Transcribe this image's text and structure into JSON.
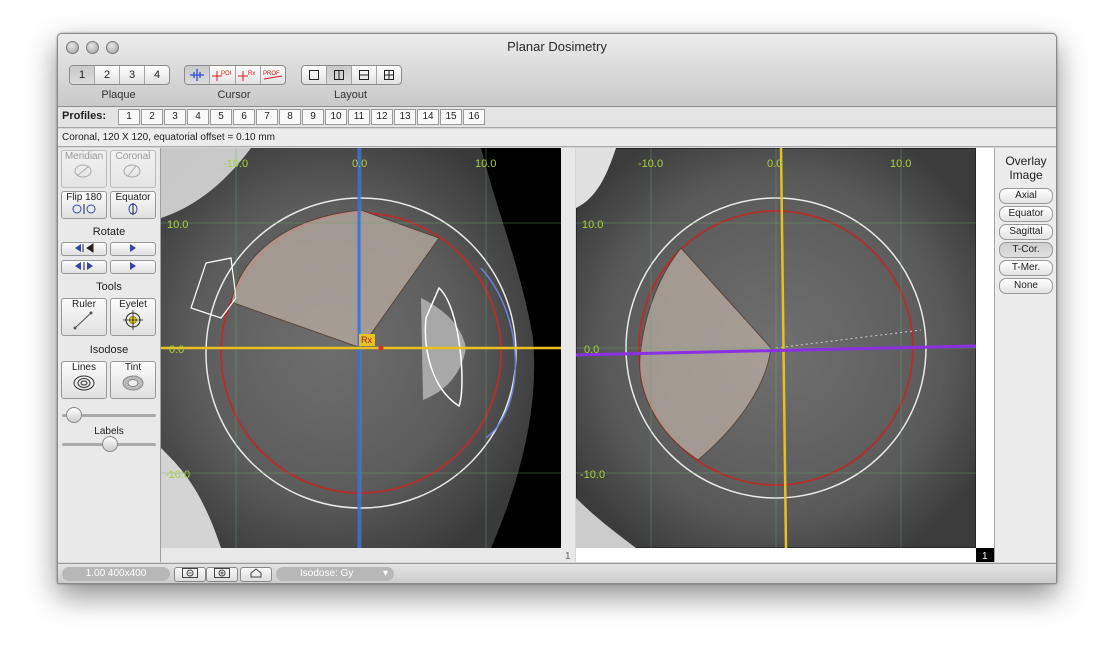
{
  "window": {
    "title": "Planar Dosimetry"
  },
  "toolbar": {
    "plaque": {
      "label": "Plaque",
      "items": [
        "1",
        "2",
        "3",
        "4"
      ],
      "selected": "1"
    },
    "cursor": {
      "label": "Cursor",
      "items": [
        "crosshair",
        "POI",
        "Rx",
        "PROF"
      ]
    },
    "layout": {
      "label": "Layout",
      "items": [
        "single",
        "two-column",
        "two-row",
        "grid"
      ],
      "selected": "two-column"
    }
  },
  "profiles": {
    "label": "Profiles:",
    "items": [
      "1",
      "2",
      "3",
      "4",
      "5",
      "6",
      "7",
      "8",
      "9",
      "10",
      "11",
      "12",
      "13",
      "14",
      "15",
      "16"
    ]
  },
  "status_text": "Coronal, 120 X 120, equatorial offset = 0.10 mm",
  "left_panel": {
    "meridian": "Meridian",
    "coronal": "Coronal",
    "flip180": "Flip 180",
    "equator": "Equator",
    "rotate": "Rotate",
    "tools": "Tools",
    "ruler": "Ruler",
    "eyelet": "Eyelet",
    "isodose": "Isodose",
    "lines": "Lines",
    "tint": "Tint",
    "labels": "Labels",
    "slider1": 0.05,
    "slider2": 0.5
  },
  "views": {
    "left": {
      "axis_labels": [
        "-10.0",
        "0.0",
        "10.0",
        "10.0",
        "0.0",
        "-10.0"
      ],
      "rx_label": "Rx",
      "index": "1"
    },
    "right": {
      "axis_labels": [
        "-10.0",
        "0.0",
        "10.0",
        "10.0",
        "0.0",
        "-10.0"
      ],
      "index": "1"
    }
  },
  "overlay": {
    "title_line1": "Overlay",
    "title_line2": "Image",
    "options": [
      "Axial",
      "Equator",
      "Sagittal",
      "T-Cor.",
      "T-Mer.",
      "None"
    ],
    "selected": "T-Cor."
  },
  "bottom": {
    "zoom": "1.00 400x400",
    "isodose": "Isodose: Gy"
  }
}
